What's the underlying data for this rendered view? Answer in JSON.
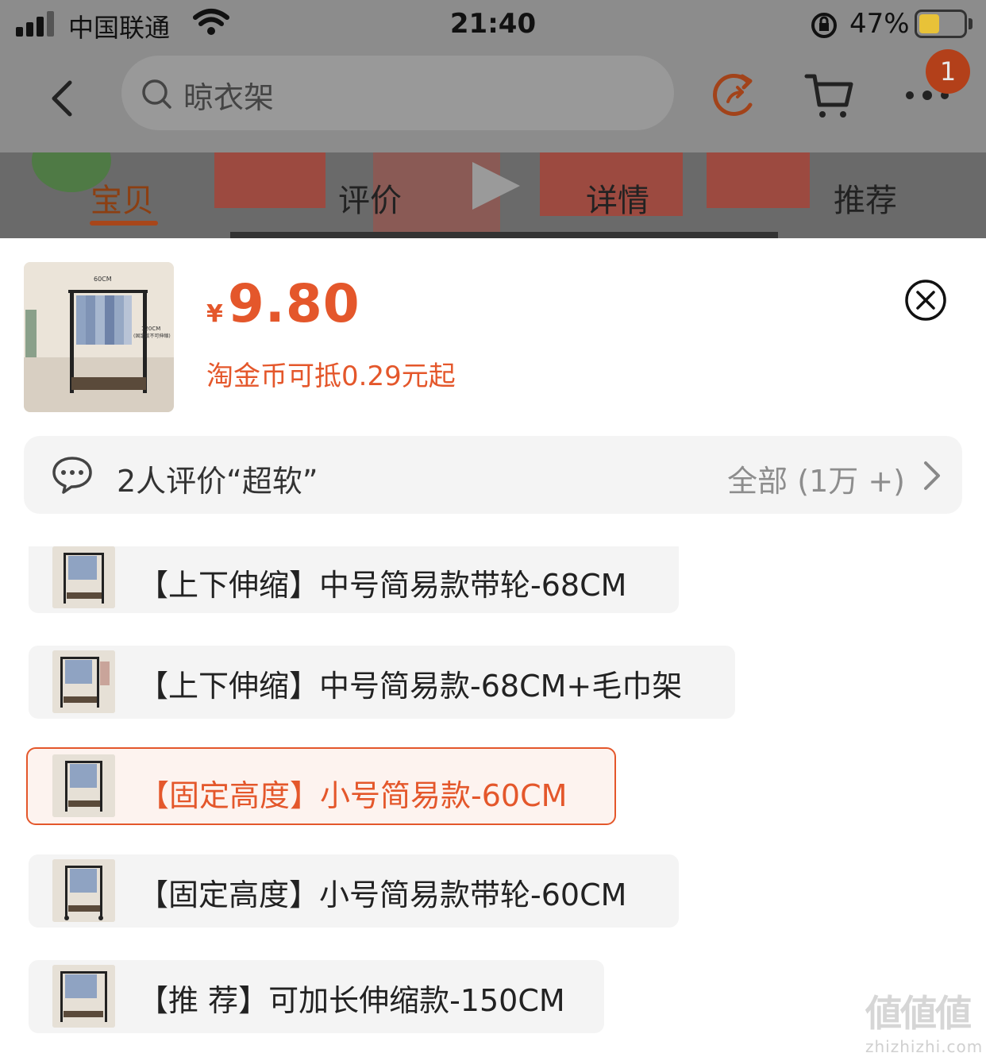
{
  "status_bar": {
    "carrier": "中国联通",
    "time": "21:40",
    "battery_percent": "47%",
    "battery_level": 0.47,
    "battery_color": "#e8c238"
  },
  "nav": {
    "search_placeholder": "晾衣架",
    "badge_count": "1",
    "icons": [
      "back-arrow-icon",
      "search-icon",
      "refresh-share-icon",
      "cart-icon",
      "more-icon"
    ]
  },
  "tabs": [
    {
      "label": "宝贝",
      "active": true
    },
    {
      "label": "评价",
      "active": false
    },
    {
      "label": "详情",
      "active": false
    },
    {
      "label": "推荐",
      "active": false
    }
  ],
  "product": {
    "currency": "¥",
    "price": "9.80",
    "coin_text": "淘金币可抵0.29元起",
    "image_labels": [
      "60CM",
      "120CM",
      "(固定款不可伸缩)"
    ]
  },
  "review": {
    "text": "2人评价“超软”",
    "all_text": "全部 (1万 +)"
  },
  "options": [
    {
      "label": "【上下伸缩】中号简易款带轮-68CM",
      "selected": false
    },
    {
      "label": "【上下伸缩】中号简易款-68CM+毛巾架",
      "selected": false
    },
    {
      "label": "【固定高度】小号简易款-60CM",
      "selected": true
    },
    {
      "label": "【固定高度】小号简易款带轮-60CM",
      "selected": false
    },
    {
      "label": "【推 荐】可加长伸缩款-150CM",
      "selected": false
    }
  ],
  "watermark": {
    "main": "値値値",
    "sub": "zhizhizhi.com"
  },
  "colors": {
    "accent": "#e4572b",
    "selected_bg": "#fdf3ef",
    "option_bg": "#f4f4f4",
    "overlay": "#8c8c8c"
  }
}
